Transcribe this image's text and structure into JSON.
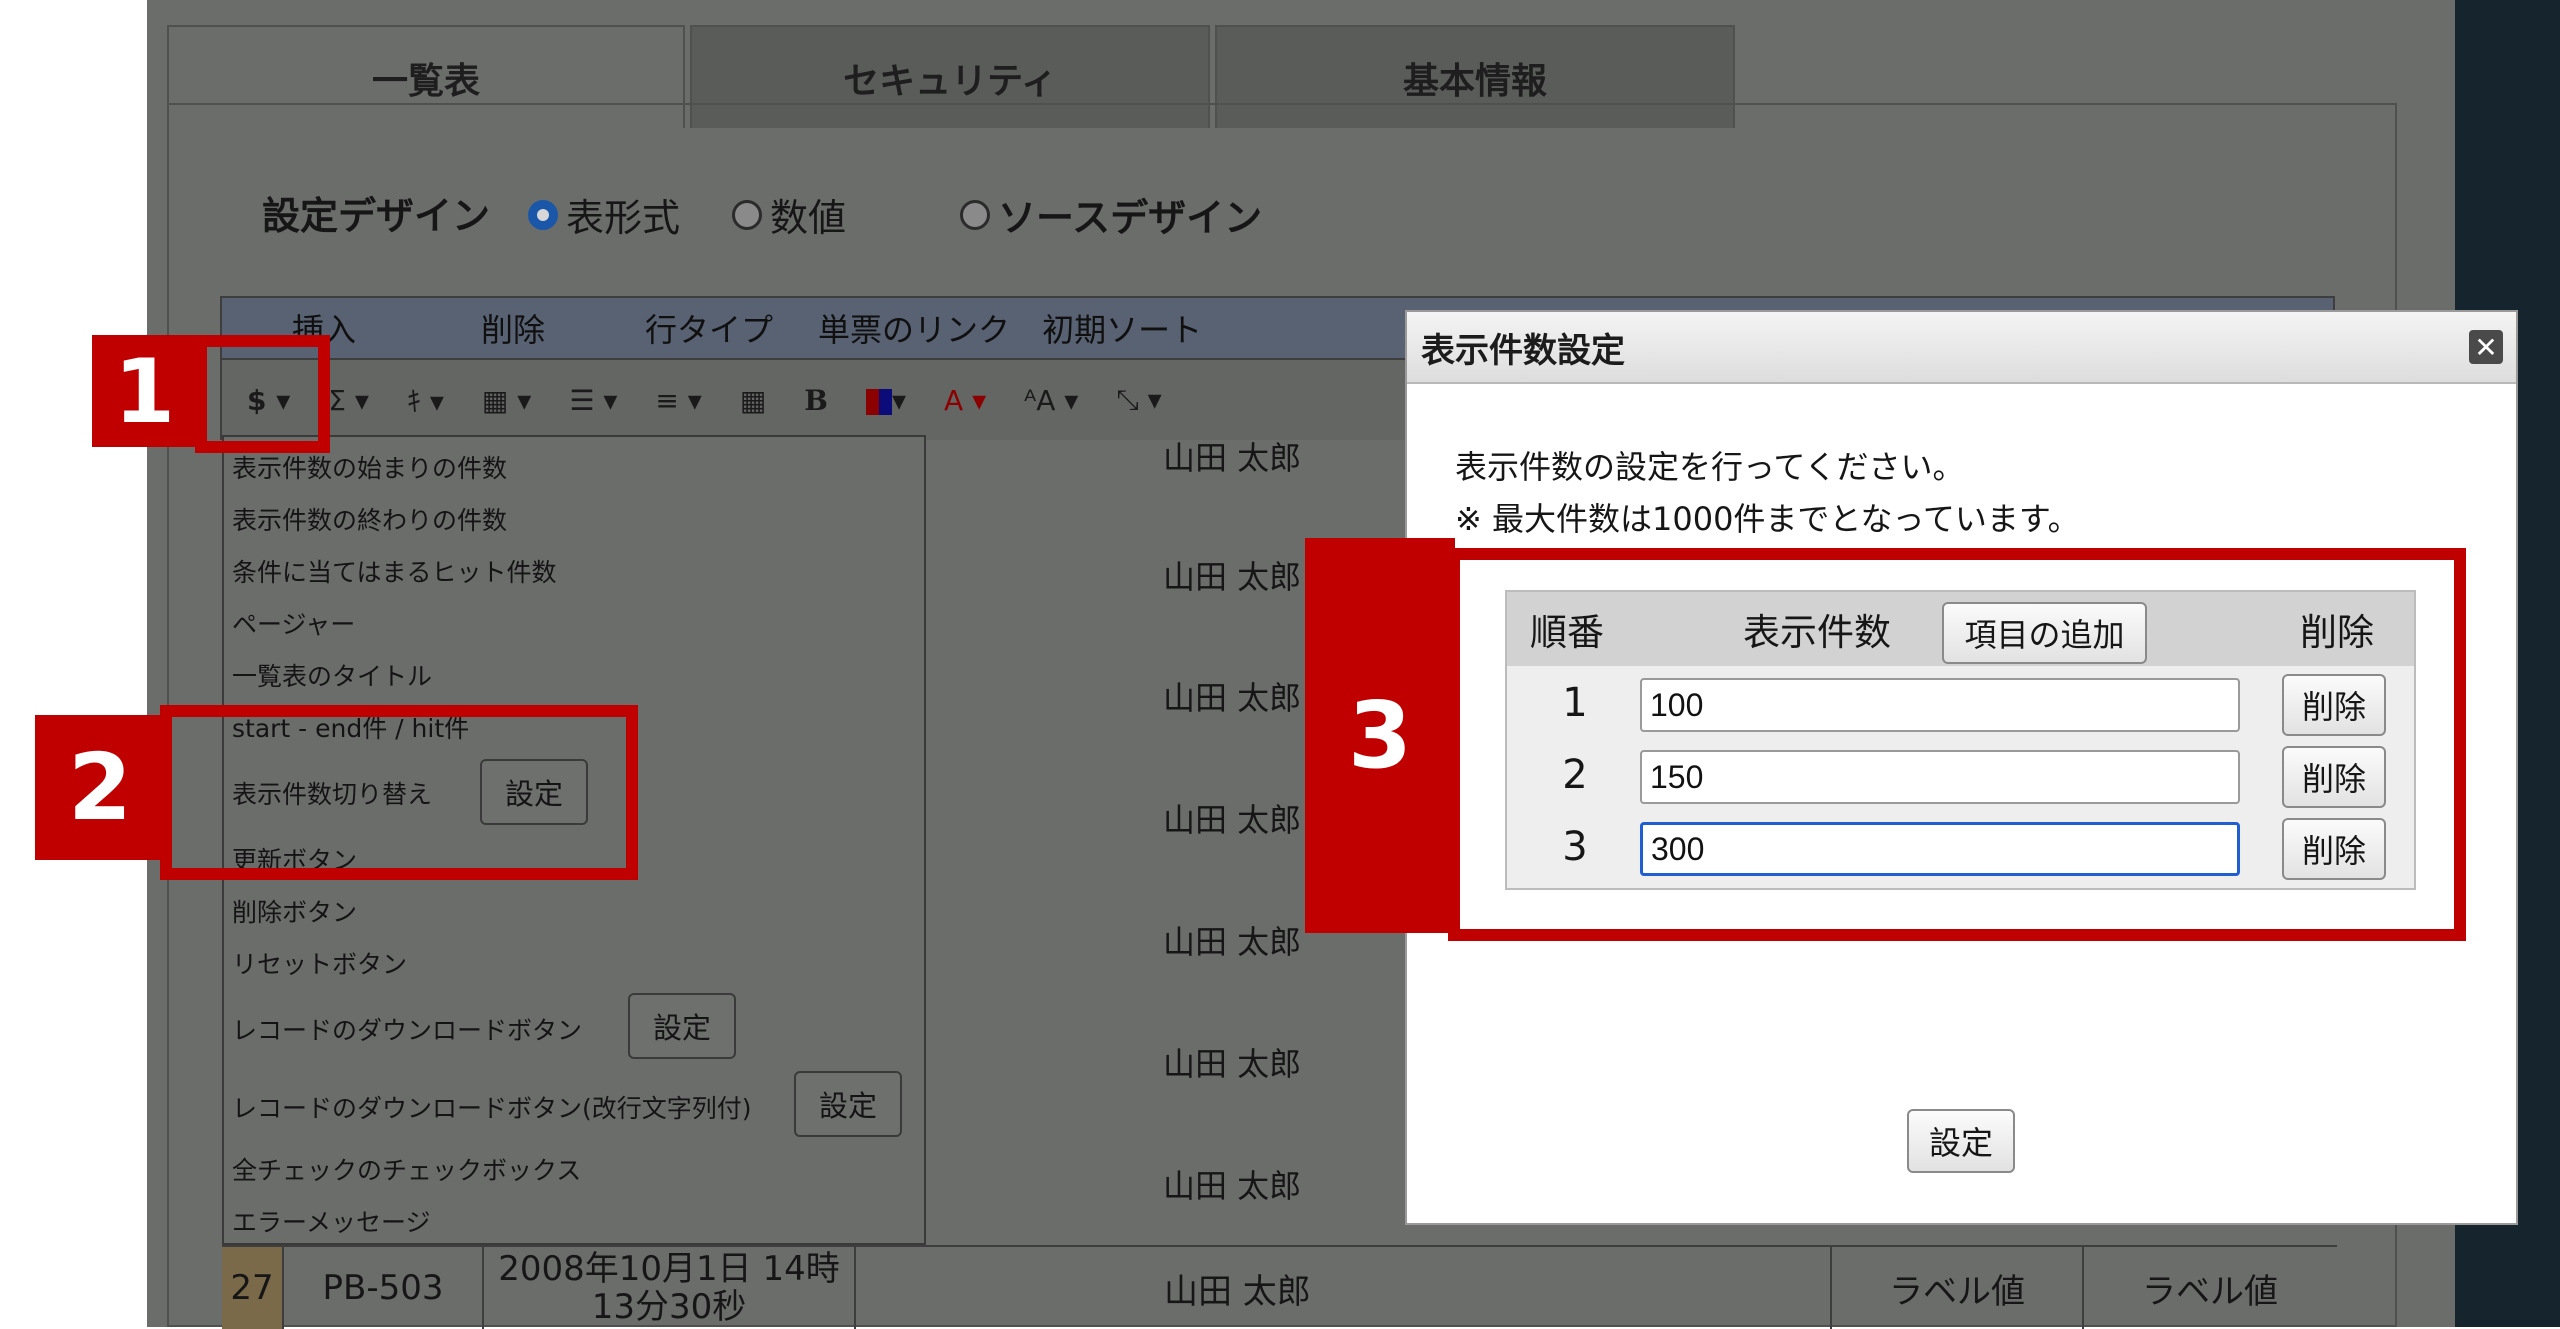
{
  "tabs": [
    {
      "label": "一覧表"
    },
    {
      "label": "セキュリティ"
    },
    {
      "label": "基本情報"
    }
  ],
  "design": {
    "label": "設定デザイン",
    "options": [
      "表形式",
      "数値",
      "ソースデザイン"
    ],
    "selected": "表形式"
  },
  "menubar": [
    "挿入",
    "削除",
    "行タイプ",
    "単票のリンク",
    "初期ソート"
  ],
  "toolbar": {
    "dollar": "$ ▾",
    "sigma": "Σ ▾",
    "strike": "ｷ ▾",
    "border": "▦ ▾",
    "valign": "☰ ▾",
    "align": "≡ ▾",
    "table": "▦",
    "bold": "B",
    "color": "▾",
    "fontcolor": "A ▾",
    "fontsize": "ᴬA ▾",
    "resize": "⤡ ▾"
  },
  "dropdown": {
    "items": [
      "表示件数の始まりの件数",
      "表示件数の終わりの件数",
      "条件に当てはまるヒット件数",
      "ページャー",
      "一覧表のタイトル",
      "start - end件 / hit件",
      "表示件数切り替え",
      "更新ボタン",
      "削除ボタン",
      "リセットボタン",
      "レコードのダウンロードボタン",
      "レコードのダウンロードボタン(改行文字列付)",
      "全チェックのチェックボックス",
      "エラーメッセージ"
    ],
    "set_label": "設定"
  },
  "table_names": [
    "山田 太郎",
    "山田 太郎",
    "山田 太郎",
    "山田 太郎",
    "山田 太郎",
    "山田 太郎",
    "山田 太郎",
    "山田 太郎"
  ],
  "row27": {
    "no": "27",
    "code": "PB-503",
    "date_line1": "2008年10月1日 14時",
    "date_line2": "13分30秒",
    "name": "山田 太郎",
    "label1": "ラベル値",
    "label2": "ラベル値"
  },
  "callouts": [
    "1",
    "2",
    "3"
  ],
  "dialog": {
    "title": "表示件数設定",
    "close": "✕",
    "instruction": "表示件数の設定を行ってください。",
    "note": "※ 最大件数は1000件までとなっています。",
    "headers": {
      "order": "順番",
      "count": "表示件数",
      "add": "項目の追加",
      "delete": "削除"
    },
    "rows": [
      {
        "order": "1",
        "value": "100",
        "delete": "削除"
      },
      {
        "order": "2",
        "value": "150",
        "delete": "削除"
      },
      {
        "order": "3",
        "value": "300",
        "delete": "削除"
      }
    ],
    "submit": "設定"
  },
  "colors": {
    "accent_red": "#c00000",
    "overlay_gray": "#6b6d6b",
    "focus_blue": "#1f5fd1"
  }
}
